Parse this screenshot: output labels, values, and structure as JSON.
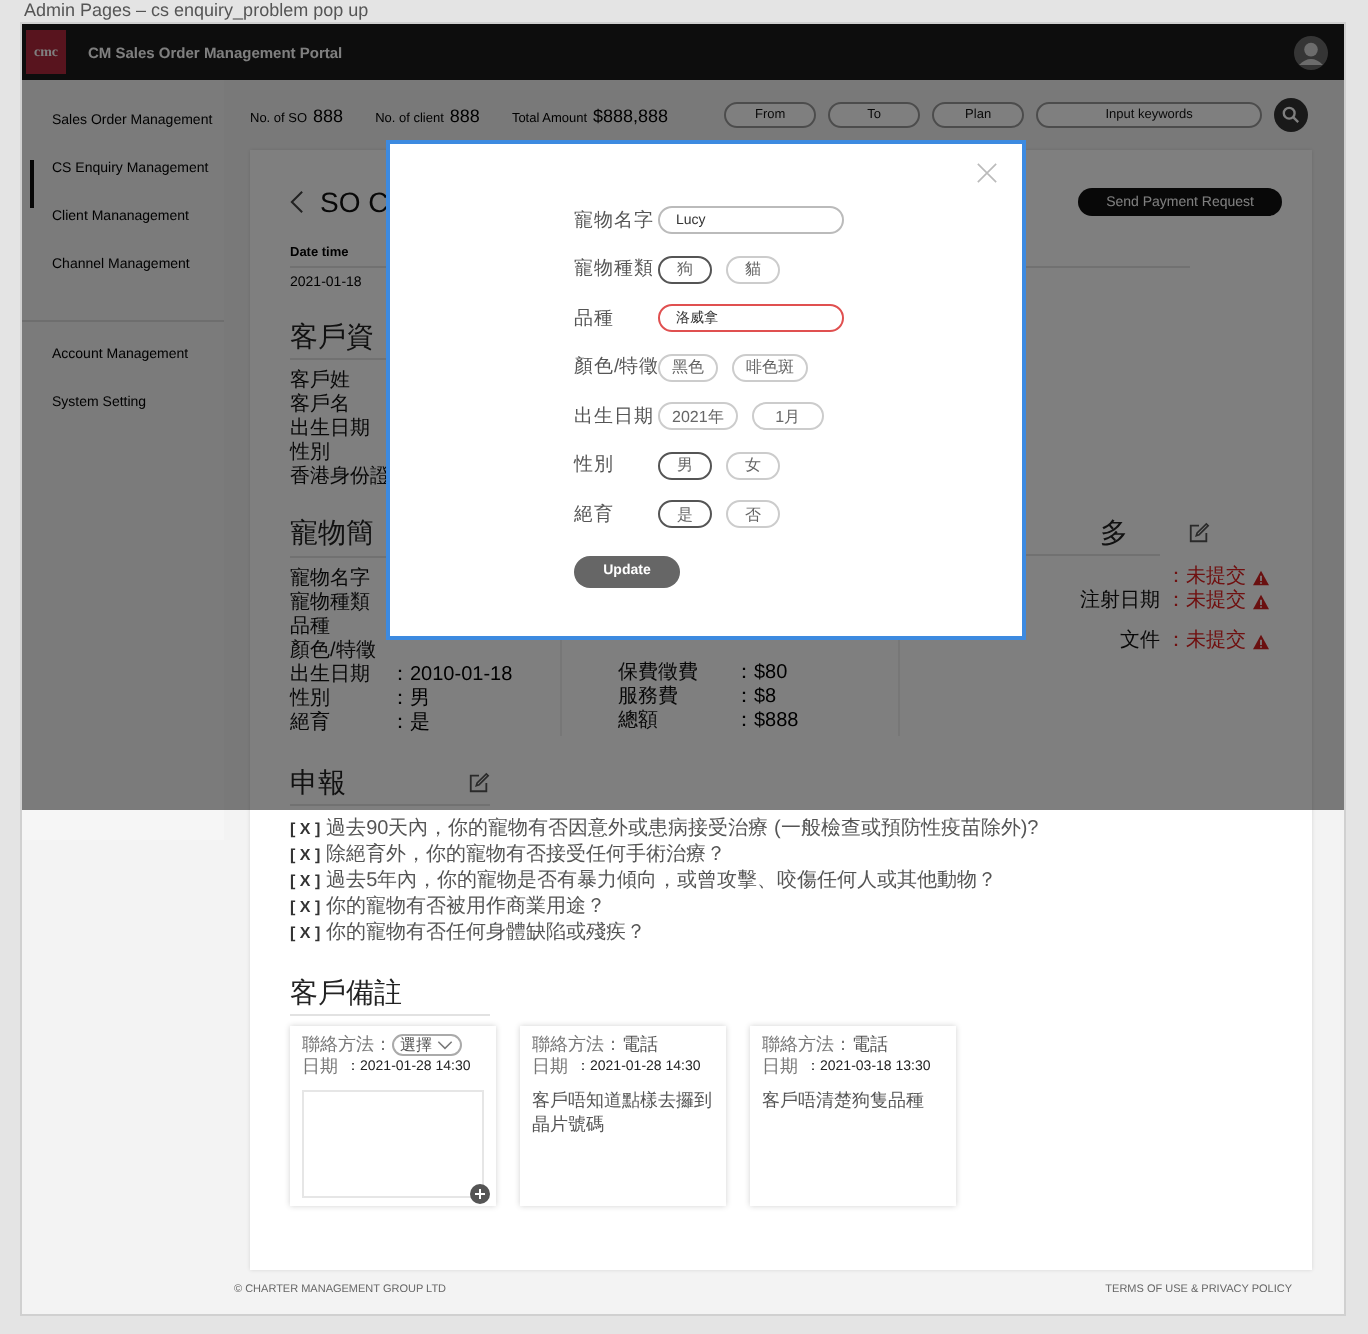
{
  "page_caption": "Admin Pages – cs enquiry_problem pop up",
  "header": {
    "logo_text": "cmc",
    "title": "CM Sales Order Management Portal"
  },
  "sidebar": {
    "groups": [
      {
        "items": [
          {
            "label": "Sales Order Management",
            "selected": false
          },
          {
            "label": "CS Enquiry Management",
            "selected": true
          },
          {
            "label": "Client Mananagement",
            "selected": false
          },
          {
            "label": "Channel Management",
            "selected": false
          }
        ]
      },
      {
        "items": [
          {
            "label": "Account Management",
            "selected": false
          },
          {
            "label": "System Setting",
            "selected": false
          }
        ]
      }
    ]
  },
  "stats": [
    {
      "label": "No. of SO",
      "value": "888"
    },
    {
      "label": "No. of client",
      "value": "888"
    },
    {
      "label": "Total Amount",
      "value": "$888,888"
    }
  ],
  "filters": [
    {
      "placeholder": "From"
    },
    {
      "placeholder": "To"
    },
    {
      "placeholder": "Plan"
    },
    {
      "placeholder": "Input keywords"
    }
  ],
  "order": {
    "title": "SO C",
    "action": "Send Payment Request",
    "column": "Date time",
    "value": "2021-01-18"
  },
  "client": {
    "heading": "客戶資",
    "labels": [
      "客戶姓",
      "客戶名",
      "出生日期",
      "性別",
      "香港身份證"
    ]
  },
  "pet": {
    "heading": "寵物簡",
    "rows": [
      {
        "label": "寵物名字"
      },
      {
        "label": "寵物種類"
      },
      {
        "label": "品種"
      },
      {
        "label": "顏色/特徵"
      },
      {
        "label": "出生日期",
        "value": "：2010-01-18"
      },
      {
        "label": "性別",
        "value": "：男"
      },
      {
        "label": "絕育",
        "value": "：是"
      }
    ]
  },
  "fees": {
    "rows": [
      {
        "label": "保費徵費",
        "value": "：$80"
      },
      {
        "label": "服務費",
        "value": "：$8"
      },
      {
        "label": "總額",
        "value": "：$888"
      }
    ]
  },
  "documents": {
    "heading": "多",
    "rows": [
      {
        "value": "：未提交"
      },
      {
        "label": "注射日期",
        "value": "：未提交"
      },
      {
        "label": "文件",
        "value": "：未提交"
      }
    ]
  },
  "declaration": {
    "heading": "申報",
    "items": [
      {
        "mark": "[ X ]",
        "text": "過去90天內，你的寵物有否因意外或患病接受治療 (一般檢查或預防性疫苗除外)?"
      },
      {
        "mark": "[ X ]",
        "text": "除絕育外，你的寵物有否接受任何手術治療？"
      },
      {
        "mark": "[ X ]",
        "text": "過去5年內，你的寵物是否有暴力傾向，或曾攻擊、咬傷任何人或其他動物？"
      },
      {
        "mark": "[ X ]",
        "text": "你的寵物有否被用作商業用途？"
      },
      {
        "mark": "[ X ]",
        "text": "你的寵物有否任何身體缺陷或殘疾？"
      }
    ]
  },
  "notes": {
    "heading": "客戶備註",
    "cards": [
      {
        "kind": "new",
        "method_label": "聯絡方法：",
        "method": "選擇",
        "date_label": "日期",
        "date": "：2021-01-28 14:30"
      },
      {
        "kind": "saved",
        "method_label": "聯絡方法：",
        "method": "電話",
        "date_label": "日期",
        "date": "：2021-01-28 14:30",
        "text": "客戶唔知道點樣去攞到晶片號碼"
      },
      {
        "kind": "saved",
        "method_label": "聯絡方法：",
        "method": "電話",
        "date_label": "日期",
        "date": "：2021-03-18 13:30",
        "text": "客戶唔清楚狗隻品種"
      }
    ]
  },
  "footer": {
    "copyright": "© CHARTER MANAGEMENT GROUP LTD",
    "links": "TERMS OF USE & PRIVACY POLICY"
  },
  "modal": {
    "fields": [
      {
        "kind": "text",
        "label": "寵物名字",
        "value": "Lucy",
        "error": false
      },
      {
        "kind": "choice",
        "label": "寵物種類",
        "options": [
          {
            "label": "狗",
            "selected": true
          },
          {
            "label": "貓",
            "selected": false
          }
        ]
      },
      {
        "kind": "text",
        "label": "品種",
        "value": "洛威拿",
        "error": true
      },
      {
        "kind": "choice",
        "label": "顏色/特徵",
        "options": [
          {
            "label": "黑色",
            "selected": false
          },
          {
            "label": "啡色斑",
            "selected": false
          }
        ]
      },
      {
        "kind": "select",
        "label": "出生日期",
        "options": [
          {
            "label": "2021年"
          },
          {
            "label": "1月"
          }
        ]
      },
      {
        "kind": "choice",
        "label": "性別",
        "options": [
          {
            "label": "男",
            "selected": true
          },
          {
            "label": "女",
            "selected": false
          }
        ]
      },
      {
        "kind": "choice",
        "label": "絕育",
        "options": [
          {
            "label": "是",
            "selected": true
          },
          {
            "label": "否",
            "selected": false
          }
        ]
      }
    ],
    "button": "Update"
  }
}
